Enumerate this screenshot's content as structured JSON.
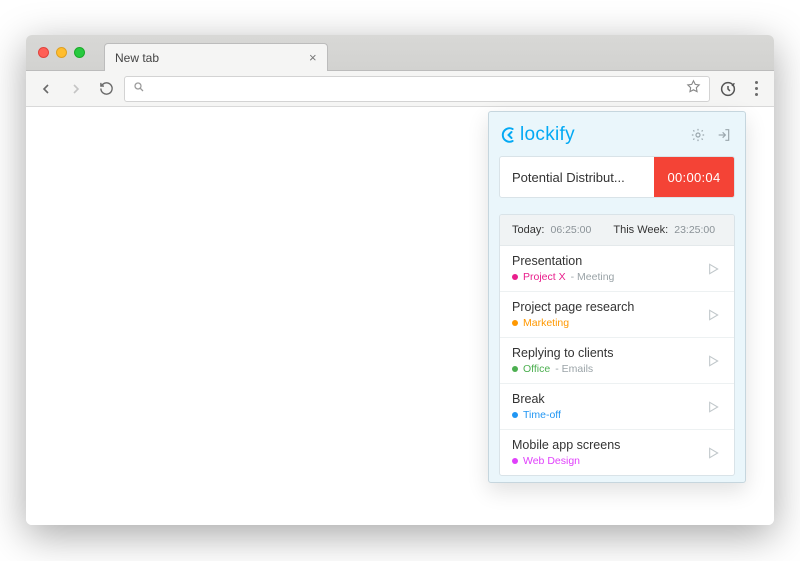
{
  "browser": {
    "tab_title": "New tab",
    "address_value": ""
  },
  "popup": {
    "brand": "lockify",
    "timer": {
      "description": "Potential Distribut...",
      "elapsed": "00:00:04"
    },
    "summary": {
      "today_label": "Today:",
      "today_value": "06:25:00",
      "week_label": "This Week:",
      "week_value": "23:25:00"
    },
    "entries": [
      {
        "title": "Presentation",
        "project": "Project X",
        "project_color": "#e91e8c",
        "task": "Meeting"
      },
      {
        "title": "Project page research",
        "project": "Marketing",
        "project_color": "#ff9800",
        "task": ""
      },
      {
        "title": "Replying to clients",
        "project": "Office",
        "project_color": "#4caf50",
        "task": "Emails"
      },
      {
        "title": "Break",
        "project": "Time-off",
        "project_color": "#2196f3",
        "task": ""
      },
      {
        "title": "Mobile app screens",
        "project": "Web Design",
        "project_color": "#e040fb",
        "task": ""
      }
    ]
  }
}
